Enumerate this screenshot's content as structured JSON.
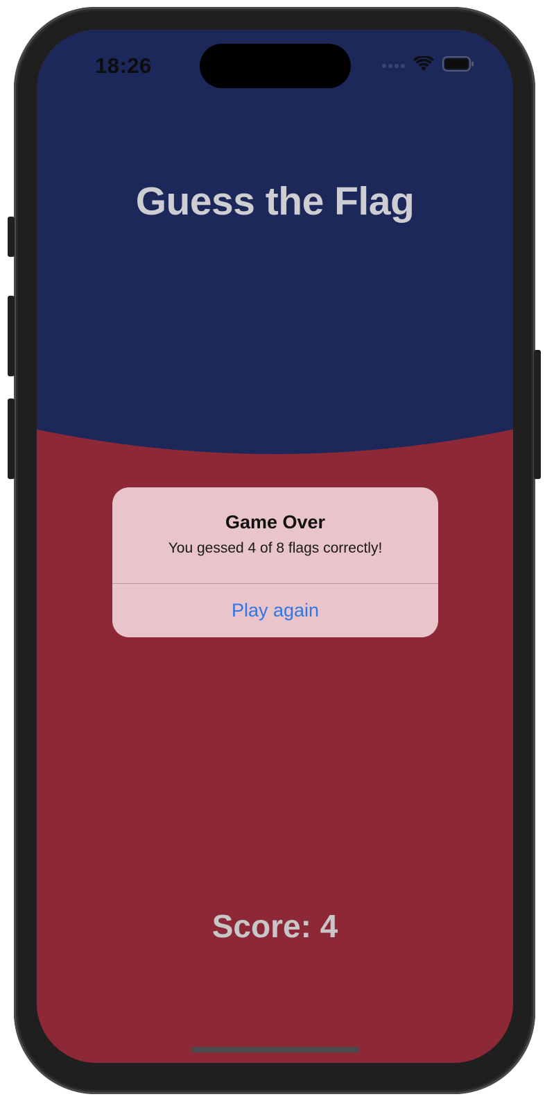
{
  "status_bar": {
    "time": "18:26"
  },
  "app": {
    "title": "Guess the Flag",
    "score_text": "Score: 4"
  },
  "alert": {
    "title": "Game Over",
    "message": "You gessed 4 of 8 flags correctly!",
    "button_label": "Play again"
  },
  "colors": {
    "top_background": "#1b2859",
    "bottom_background": "#8d2836",
    "alert_background": "#e9c4ca",
    "alert_button": "#2f76e6",
    "title_text": "#cdcdd2"
  },
  "icons": [
    "cellular-signal-icon",
    "wifi-icon",
    "battery-icon"
  ]
}
